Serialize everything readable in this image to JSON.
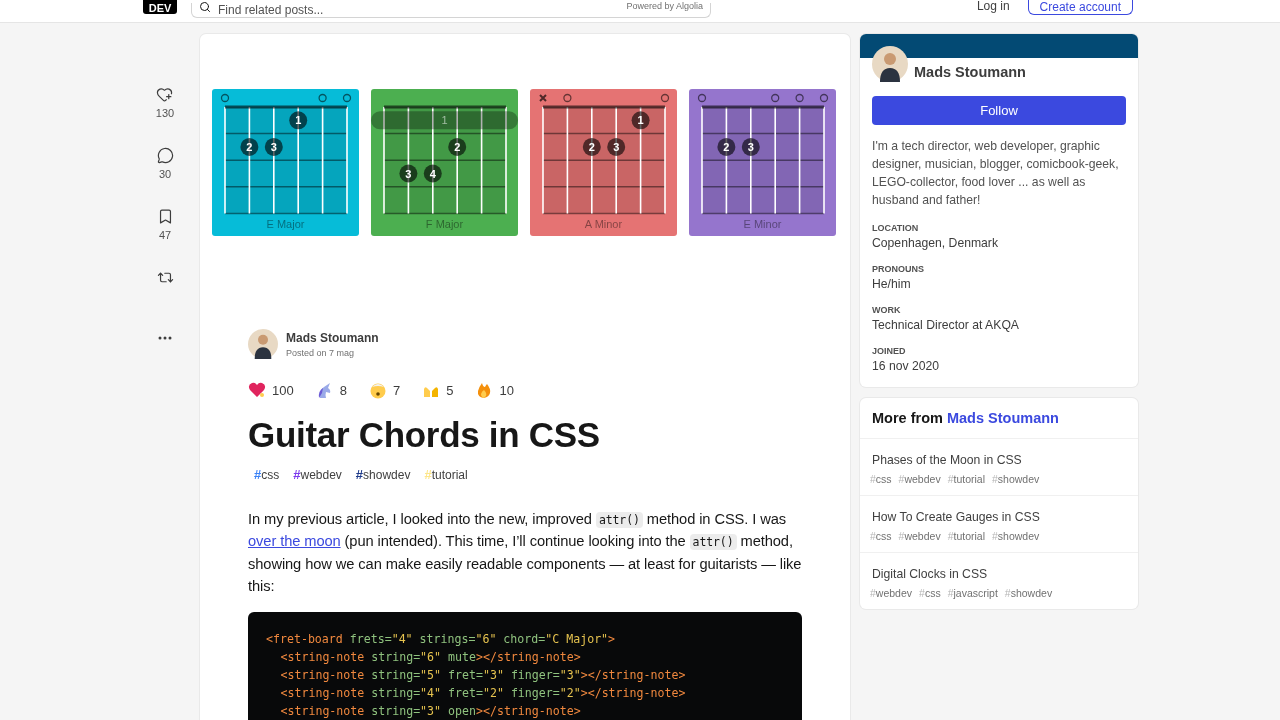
{
  "header": {
    "logo": "DEV",
    "search": {
      "placeholder": "Find related posts...",
      "powered_by": "Powered by",
      "provider": "Algolia"
    },
    "login": "Log in",
    "create_account": "Create account"
  },
  "actions": [
    {
      "kind": "reaction",
      "count": "130"
    },
    {
      "kind": "comment",
      "count": "30"
    },
    {
      "kind": "bookmark",
      "count": "47"
    },
    {
      "kind": "repost"
    },
    {
      "kind": "more"
    }
  ],
  "cover": {
    "chords": [
      {
        "name": "E Major",
        "color": "#06bcd8",
        "top": [
          {
            "kind": "open"
          },
          {
            "kind": "none"
          },
          {
            "kind": "none"
          },
          {
            "kind": "none"
          },
          {
            "kind": "open"
          },
          {
            "kind": "open"
          }
        ],
        "frets": [
          [
            {
              "kind": "empty"
            },
            {
              "kind": "empty"
            },
            {
              "kind": "empty"
            },
            {
              "kind": "note",
              "finger": "1"
            },
            {
              "kind": "empty"
            },
            {
              "kind": "empty"
            }
          ],
          [
            {
              "kind": "empty"
            },
            {
              "kind": "note",
              "finger": "2"
            },
            {
              "kind": "note",
              "finger": "3"
            },
            {
              "kind": "empty"
            },
            {
              "kind": "empty"
            },
            {
              "kind": "empty"
            }
          ]
        ]
      },
      {
        "name": "F Major",
        "color": "#4caf50",
        "barre": "1",
        "frets": [
          [
            {
              "kind": "empty"
            },
            {
              "kind": "empty"
            },
            {
              "kind": "empty"
            },
            {
              "kind": "empty"
            },
            {
              "kind": "empty"
            },
            {
              "kind": "empty"
            }
          ],
          [
            {
              "kind": "empty"
            },
            {
              "kind": "empty"
            },
            {
              "kind": "empty"
            },
            {
              "kind": "note",
              "finger": "2"
            },
            {
              "kind": "empty"
            },
            {
              "kind": "empty"
            }
          ],
          [
            {
              "kind": "empty"
            },
            {
              "kind": "note",
              "finger": "3"
            },
            {
              "kind": "note",
              "finger": "4"
            },
            {
              "kind": "empty"
            },
            {
              "kind": "empty"
            },
            {
              "kind": "empty"
            }
          ]
        ]
      },
      {
        "name": "A Minor",
        "color": "#e57373",
        "top": [
          {
            "kind": "mute"
          },
          {
            "kind": "open"
          },
          {
            "kind": "none"
          },
          {
            "kind": "none"
          },
          {
            "kind": "none"
          },
          {
            "kind": "open"
          }
        ],
        "frets": [
          [
            {
              "kind": "empty"
            },
            {
              "kind": "empty"
            },
            {
              "kind": "empty"
            },
            {
              "kind": "empty"
            },
            {
              "kind": "note",
              "finger": "1"
            },
            {
              "kind": "empty"
            }
          ],
          [
            {
              "kind": "empty"
            },
            {
              "kind": "empty"
            },
            {
              "kind": "note",
              "finger": "2"
            },
            {
              "kind": "note",
              "finger": "3"
            },
            {
              "kind": "empty"
            },
            {
              "kind": "empty"
            }
          ]
        ]
      },
      {
        "name": "E Minor",
        "color": "#9575cd",
        "top": [
          {
            "kind": "open"
          },
          {
            "kind": "none"
          },
          {
            "kind": "none"
          },
          {
            "kind": "open"
          },
          {
            "kind": "open"
          },
          {
            "kind": "open"
          }
        ],
        "frets": [
          [
            {
              "kind": "empty"
            },
            {
              "kind": "empty"
            },
            {
              "kind": "empty"
            },
            {
              "kind": "empty"
            },
            {
              "kind": "empty"
            },
            {
              "kind": "empty"
            }
          ],
          [
            {
              "kind": "empty"
            },
            {
              "kind": "note",
              "finger": "2"
            },
            {
              "kind": "note",
              "finger": "3"
            },
            {
              "kind": "empty"
            },
            {
              "kind": "empty"
            },
            {
              "kind": "empty"
            }
          ]
        ]
      }
    ]
  },
  "article": {
    "author": "Mads Stoumann",
    "posted": "Posted on 7 mag",
    "reactions": [
      {
        "kind": "heart",
        "count": "100"
      },
      {
        "kind": "unicorn",
        "count": "8"
      },
      {
        "kind": "exploding",
        "count": "7"
      },
      {
        "kind": "hands",
        "count": "5"
      },
      {
        "kind": "fire",
        "count": "10"
      }
    ],
    "title": "Guitar Chords in CSS",
    "tags": [
      {
        "hash": "#",
        "name": "css",
        "color": "#3b82f6"
      },
      {
        "hash": "#",
        "name": "webdev",
        "color": "#7c3aed"
      },
      {
        "hash": "#",
        "name": "showdev",
        "color": "#1e3a8a"
      },
      {
        "hash": "#",
        "name": "tutorial",
        "color": "#fde68a"
      }
    ],
    "paragraph": [
      {
        "kind": "text",
        "text": "In my previous article, I looked into the new, improved "
      },
      {
        "kind": "code",
        "text": "attr()"
      },
      {
        "kind": "text",
        "text": " method in CSS. I was "
      },
      {
        "kind": "link",
        "text": "over the moon"
      },
      {
        "kind": "text",
        "text": " (pun intended). This time, I’ll continue looking into the "
      },
      {
        "kind": "code",
        "text": "attr()"
      },
      {
        "kind": "text",
        "text": " method, showing how we can make easily readable components — at least for guitarists — like this:"
      }
    ],
    "code": [
      {
        "indent": false,
        "tokens": [
          {
            "kind": "tag",
            "text": "<fret-board"
          },
          {
            "kind": "attr",
            "text": " frets="
          },
          {
            "kind": "value",
            "text": "\"4\""
          },
          {
            "kind": "attr",
            "text": " strings="
          },
          {
            "kind": "value",
            "text": "\"6\""
          },
          {
            "kind": "attr",
            "text": " chord="
          },
          {
            "kind": "value",
            "text": "\"C Major\""
          },
          {
            "kind": "tag",
            "text": ">"
          }
        ]
      },
      {
        "indent": true,
        "tokens": [
          {
            "kind": "tag",
            "text": "<string-note"
          },
          {
            "kind": "attr",
            "text": " string="
          },
          {
            "kind": "value",
            "text": "\"6\""
          },
          {
            "kind": "attr",
            "text": " mute"
          },
          {
            "kind": "tag",
            "text": "></string-note>"
          }
        ]
      },
      {
        "indent": true,
        "tokens": [
          {
            "kind": "tag",
            "text": "<string-note"
          },
          {
            "kind": "attr",
            "text": " string="
          },
          {
            "kind": "value",
            "text": "\"5\""
          },
          {
            "kind": "attr",
            "text": " fret="
          },
          {
            "kind": "value",
            "text": "\"3\""
          },
          {
            "kind": "attr",
            "text": " finger="
          },
          {
            "kind": "value",
            "text": "\"3\""
          },
          {
            "kind": "tag",
            "text": "></string-note>"
          }
        ]
      },
      {
        "indent": true,
        "tokens": [
          {
            "kind": "tag",
            "text": "<string-note"
          },
          {
            "kind": "attr",
            "text": " string="
          },
          {
            "kind": "value",
            "text": "\"4\""
          },
          {
            "kind": "attr",
            "text": " fret="
          },
          {
            "kind": "value",
            "text": "\"2\""
          },
          {
            "kind": "attr",
            "text": " finger="
          },
          {
            "kind": "value",
            "text": "\"2\""
          },
          {
            "kind": "tag",
            "text": "></string-note>"
          }
        ]
      },
      {
        "indent": true,
        "tokens": [
          {
            "kind": "tag",
            "text": "<string-note"
          },
          {
            "kind": "attr",
            "text": " string="
          },
          {
            "kind": "value",
            "text": "\"3\""
          },
          {
            "kind": "attr",
            "text": " open"
          },
          {
            "kind": "tag",
            "text": "></string-note>"
          }
        ]
      }
    ]
  },
  "profile": {
    "name": "Mads Stoumann",
    "follow": "Follow",
    "bio": "I'm a tech director, web developer, graphic designer, musician, blogger, comicbook-geek, LEGO-collector, food lover ... as well as husband and father!",
    "details": [
      {
        "label": "LOCATION",
        "value": "Copenhagen, Denmark"
      },
      {
        "label": "PRONOUNS",
        "value": "He/him"
      },
      {
        "label": "WORK",
        "value": "Technical Director at AKQA"
      },
      {
        "label": "JOINED",
        "value": "16 nov 2020"
      }
    ]
  },
  "more_from": {
    "heading": "More from",
    "author": "Mads Stoumann",
    "posts": [
      {
        "title": "Phases of the Moon in CSS",
        "tags": [
          "css",
          "webdev",
          "tutorial",
          "showdev"
        ],
        "hash": "#"
      },
      {
        "title": "How To Create Gauges in CSS",
        "tags": [
          "css",
          "webdev",
          "tutorial",
          "showdev"
        ],
        "hash": "#"
      },
      {
        "title": "Digital Clocks in CSS",
        "tags": [
          "webdev",
          "css",
          "javascript",
          "showdev"
        ],
        "hash": "#"
      }
    ]
  }
}
